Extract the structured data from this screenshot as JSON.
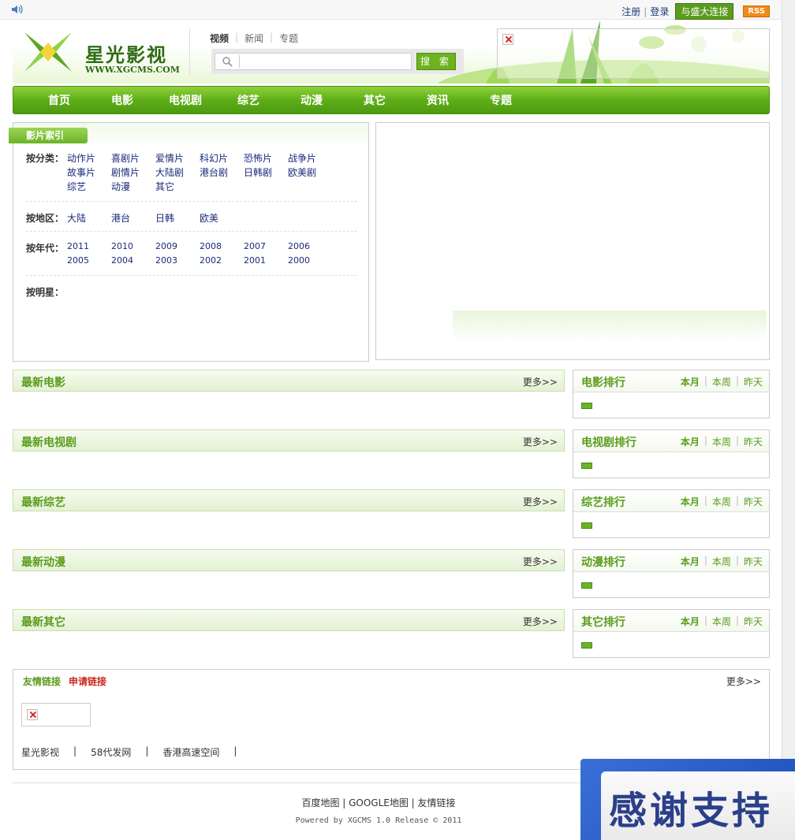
{
  "topbar": {
    "register": "注册",
    "login": "登录",
    "partner": "与盛大连接",
    "rss": "RSS"
  },
  "header": {
    "logo_title": "星光影视",
    "logo_sub": "WWW.XGCMS.COM",
    "search_tabs": [
      "视频",
      "新闻",
      "专题"
    ],
    "search_placeholder": "",
    "search_button": "搜 索"
  },
  "nav": [
    "首页",
    "电影",
    "电视剧",
    "综艺",
    "动漫",
    "其它",
    "资讯",
    "专题"
  ],
  "index": {
    "title": "影片索引",
    "category_label": "按分类：",
    "categories": [
      "动作片",
      "喜剧片",
      "爱情片",
      "科幻片",
      "恐怖片",
      "战争片",
      "故事片",
      "剧情片",
      "大陆剧",
      "港台剧",
      "日韩剧",
      "欧美剧",
      "综艺",
      "动漫",
      "其它"
    ],
    "region_label": "按地区：",
    "regions": [
      "大陆",
      "港台",
      "日韩",
      "欧美"
    ],
    "year_label": "按年代：",
    "years": [
      "2011",
      "2010",
      "2009",
      "2008",
      "2007",
      "2006",
      "2005",
      "2004",
      "2003",
      "2002",
      "2001",
      "2000"
    ],
    "star_label": "按明星："
  },
  "sections": [
    {
      "title": "最新电影",
      "more": "更多>>",
      "rank_title": "电影排行"
    },
    {
      "title": "最新电视剧",
      "more": "更多>>",
      "rank_title": "电视剧排行"
    },
    {
      "title": "最新综艺",
      "more": "更多>>",
      "rank_title": "综艺排行"
    },
    {
      "title": "最新动漫",
      "more": "更多>>",
      "rank_title": "动漫排行"
    },
    {
      "title": "最新其它",
      "more": "更多>>",
      "rank_title": "其它排行"
    }
  ],
  "rank_options": [
    "本月",
    "本周",
    "昨天"
  ],
  "links": {
    "title": "友情链接",
    "apply": "申请链接",
    "more": "更多>>",
    "items": [
      "星光影视",
      "|",
      "58代发网",
      "|",
      "香港高速空间",
      "|"
    ]
  },
  "footer": {
    "links": "百度地图 | GOOGLE地图 | 友情链接",
    "powered": "Powered by XGCMS 1.0 Release © 2011"
  },
  "banner": {
    "text": "感谢支持"
  },
  "colors": {
    "brand_green": "#5fae18",
    "title_green": "#5a9c1c",
    "link_blue": "#1a2a7a",
    "apply_red": "#c8281e"
  }
}
